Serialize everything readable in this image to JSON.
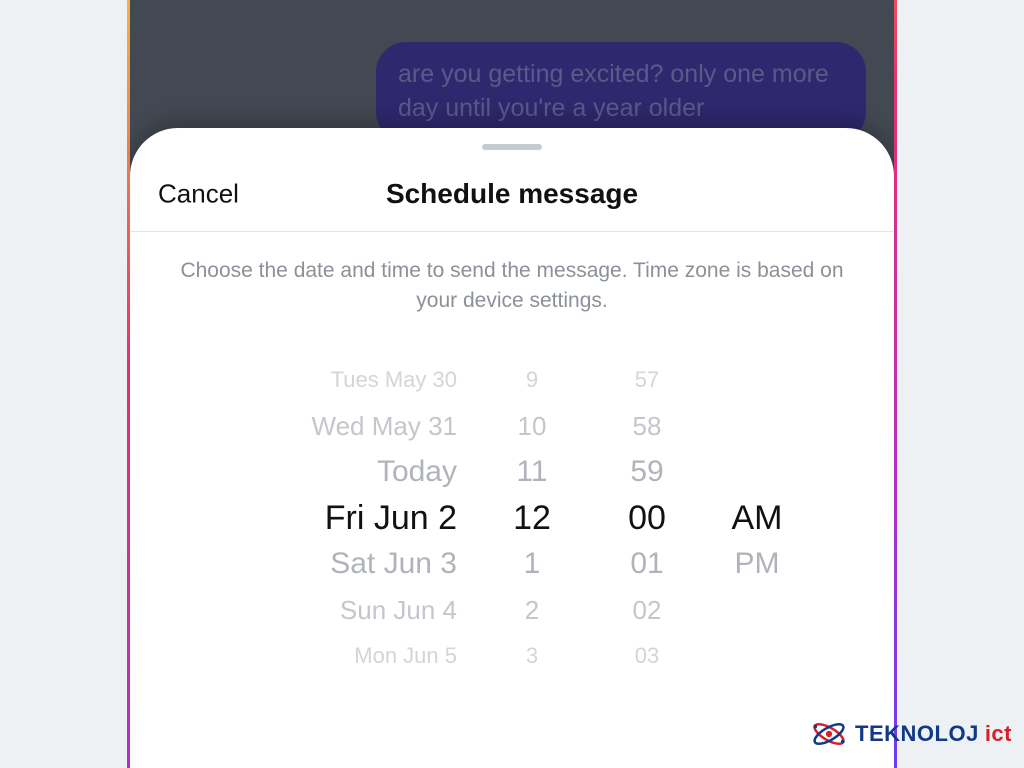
{
  "chat": {
    "lastMessage": "are you getting excited? only one more day until you're a year older"
  },
  "sheet": {
    "cancel": "Cancel",
    "title": "Schedule message",
    "instructions": "Choose the date and time to send the message. Time zone is based on your device settings."
  },
  "picker": {
    "date": {
      "minus3": "Tues May 30",
      "minus2": "Wed May 31",
      "minus1": "Today",
      "selected": "Fri Jun 2",
      "plus1": "Sat Jun 3",
      "plus2": "Sun Jun 4",
      "plus3": "Mon Jun 5"
    },
    "hour": {
      "minus3": "9",
      "minus2": "10",
      "minus1": "11",
      "selected": "12",
      "plus1": "1",
      "plus2": "2",
      "plus3": "3"
    },
    "minute": {
      "minus3": "57",
      "minus2": "58",
      "minus1": "59",
      "selected": "00",
      "plus1": "01",
      "plus2": "02",
      "plus3": "03"
    },
    "ampm": {
      "selected": "AM",
      "plus1": "PM"
    }
  },
  "watermark": {
    "part1": "TEKNOLOJ",
    "part2": "ict"
  }
}
